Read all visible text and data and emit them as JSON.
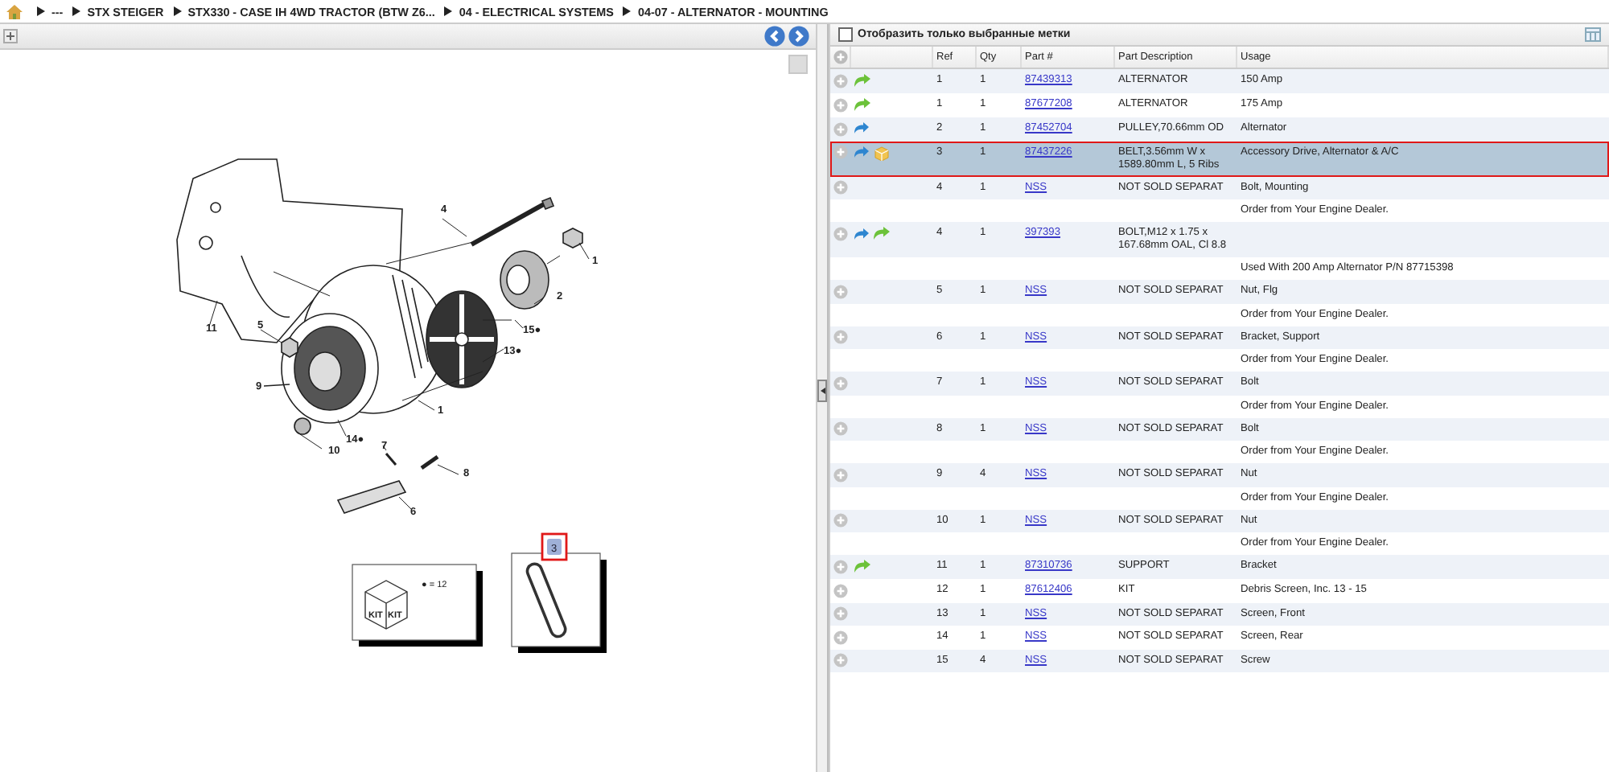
{
  "breadcrumb": [
    "---",
    "STX STEIGER",
    "STX330 - CASE IH 4WD TRACTOR (BTW Z6...",
    "04 - ELECTRICAL SYSTEMS",
    "04-07 - ALTERNATOR - MOUNTING"
  ],
  "diagram": {
    "callouts": [
      "4",
      "1",
      "2",
      "11",
      "5",
      "15●",
      "13●",
      "9",
      "1",
      "14●",
      "10",
      "7",
      "8",
      "6"
    ],
    "kit_labels": [
      "KIT",
      "KIT"
    ],
    "legend": "● = 12",
    "highlight": {
      "label": "3",
      "selected": true
    }
  },
  "filter": {
    "label": "Отобразить только выбранные метки",
    "checked": false
  },
  "table": {
    "columns": [
      "Ref",
      "Qty",
      "Part #",
      "Part Description",
      "Usage"
    ],
    "rows": [
      {
        "back": false,
        "forward": true,
        "package": false,
        "ref": "1",
        "qty": "1",
        "part": "87439313",
        "description": "ALTERNATOR",
        "usage": "150 Amp",
        "selected": false
      },
      {
        "back": false,
        "forward": true,
        "package": false,
        "ref": "1",
        "qty": "1",
        "part": "87677208",
        "description": "ALTERNATOR",
        "usage": "175 Amp",
        "selected": false
      },
      {
        "back": true,
        "forward": false,
        "package": false,
        "ref": "2",
        "qty": "1",
        "part": "87452704",
        "description": "PULLEY,70.66mm OD",
        "usage": "Alternator",
        "selected": false
      },
      {
        "back": true,
        "forward": false,
        "package": true,
        "ref": "3",
        "qty": "1",
        "part": "87437226",
        "description": "BELT,3.56mm W x 1589.80mm L, 5 Ribs",
        "usage": "Accessory Drive, Alternator & A/C",
        "selected": true
      },
      {
        "back": false,
        "forward": false,
        "package": false,
        "ref": "4",
        "qty": "1",
        "part": "NSS",
        "description": "NOT SOLD SEPARAT",
        "usage": "Bolt, Mounting",
        "note": "Order from Your Engine Dealer.",
        "selected": false
      },
      {
        "back": true,
        "forward": true,
        "package": false,
        "ref": "4",
        "qty": "1",
        "part": "397393",
        "description": "BOLT,M12 x 1.75 x 167.68mm OAL, Cl 8.8",
        "note": "Used With 200 Amp Alternator P/N 87715398",
        "selected": false
      },
      {
        "back": false,
        "forward": false,
        "package": false,
        "ref": "5",
        "qty": "1",
        "part": "NSS",
        "description": "NOT SOLD SEPARAT",
        "usage": "Nut, Flg",
        "note": "Order from Your Engine Dealer.",
        "selected": false
      },
      {
        "back": false,
        "forward": false,
        "package": false,
        "ref": "6",
        "qty": "1",
        "part": "NSS",
        "description": "NOT SOLD SEPARAT",
        "usage": "Bracket, Support",
        "note": "Order from Your Engine Dealer.",
        "selected": false
      },
      {
        "back": false,
        "forward": false,
        "package": false,
        "ref": "7",
        "qty": "1",
        "part": "NSS",
        "description": "NOT SOLD SEPARAT",
        "usage": "Bolt",
        "note": "Order from Your Engine Dealer.",
        "selected": false
      },
      {
        "back": false,
        "forward": false,
        "package": false,
        "ref": "8",
        "qty": "1",
        "part": "NSS",
        "description": "NOT SOLD SEPARAT",
        "usage": "Bolt",
        "note": "Order from Your Engine Dealer.",
        "selected": false
      },
      {
        "back": false,
        "forward": false,
        "package": false,
        "ref": "9",
        "qty": "4",
        "part": "NSS",
        "description": "NOT SOLD SEPARAT",
        "usage": "Nut",
        "note": "Order from Your Engine Dealer.",
        "selected": false
      },
      {
        "back": false,
        "forward": false,
        "package": false,
        "ref": "10",
        "qty": "1",
        "part": "NSS",
        "description": "NOT SOLD SEPARAT",
        "usage": "Nut",
        "note": "Order from Your Engine Dealer.",
        "selected": false
      },
      {
        "back": false,
        "forward": true,
        "package": false,
        "ref": "11",
        "qty": "1",
        "part": "87310736",
        "description": "SUPPORT",
        "usage": "Bracket",
        "selected": false
      },
      {
        "back": false,
        "forward": false,
        "package": false,
        "ref": "12",
        "qty": "1",
        "part": "87612406",
        "description": "KIT",
        "usage": "Debris Screen, Inc. 13 - 15",
        "selected": false
      },
      {
        "back": false,
        "forward": false,
        "package": false,
        "ref": "13",
        "qty": "1",
        "part": "NSS",
        "description": "NOT SOLD SEPARAT",
        "usage": "Screen, Front",
        "selected": false
      },
      {
        "back": false,
        "forward": false,
        "package": false,
        "ref": "14",
        "qty": "1",
        "part": "NSS",
        "description": "NOT SOLD SEPARAT",
        "usage": "Screen, Rear",
        "selected": false
      },
      {
        "back": false,
        "forward": false,
        "package": false,
        "ref": "15",
        "qty": "4",
        "part": "NSS",
        "description": "NOT SOLD SEPARAT",
        "usage": "Screw",
        "selected": false
      }
    ]
  }
}
